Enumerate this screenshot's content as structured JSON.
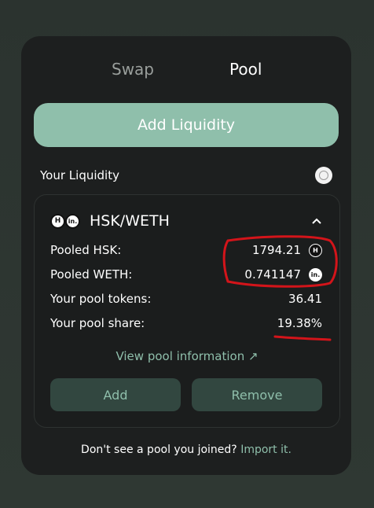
{
  "tabs": [
    {
      "label": "Swap"
    },
    {
      "label": "Pool"
    }
  ],
  "actions": {
    "add_liquidity": "Add Liquidity"
  },
  "liquidity": {
    "title": "Your Liquidity",
    "pool": {
      "pair": "HSK/WETH",
      "token_a_icon": "H",
      "token_b_icon": "in.",
      "rows": [
        {
          "label": "Pooled HSK:",
          "value": "1794.21"
        },
        {
          "label": "Pooled WETH:",
          "value": "0.741147"
        },
        {
          "label": "Your pool tokens:",
          "value": "36.41"
        },
        {
          "label": "Your pool share:",
          "value": "19.38%"
        }
      ],
      "view_info": "View pool information ↗",
      "add_label": "Add",
      "remove_label": "Remove"
    }
  },
  "footer": {
    "text": "Don't see a pool you joined?",
    "link": "Import it."
  },
  "colors": {
    "accent": "#8fbfab",
    "card_bg": "#1d1f1f",
    "annotation": "#d3141a"
  }
}
